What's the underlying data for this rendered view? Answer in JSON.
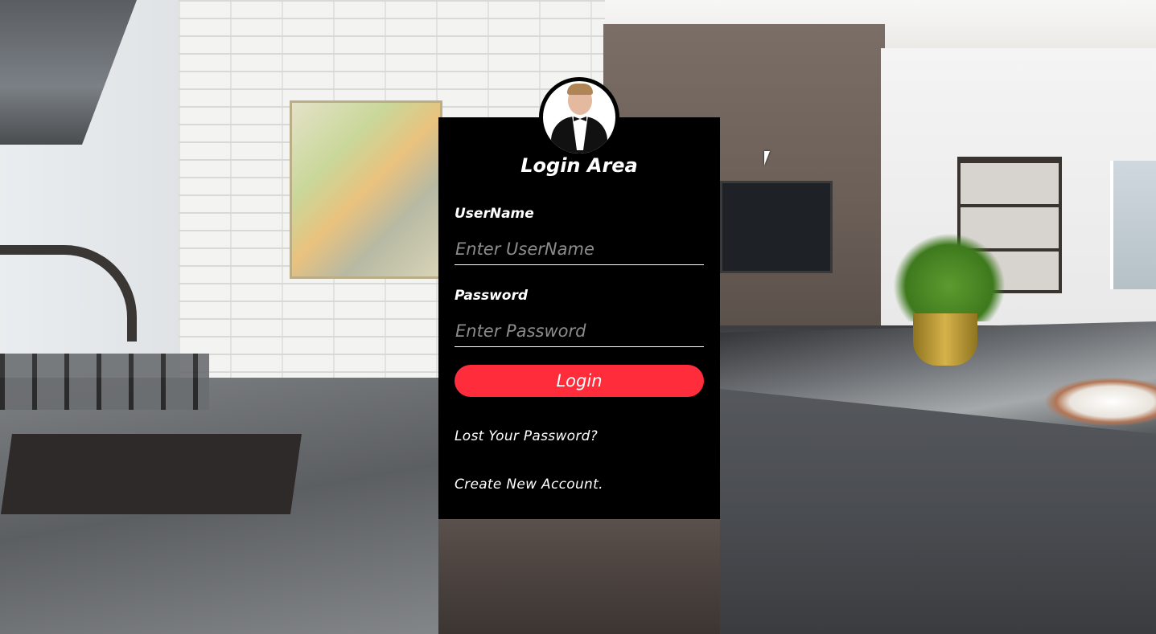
{
  "login": {
    "title": "Login Area",
    "username_label": "UserName",
    "username_placeholder": "Enter UserName",
    "password_label": "Password",
    "password_placeholder": "Enter Password",
    "login_button": "Login",
    "lost_password_link": "Lost Your Password?",
    "create_account_link": "Create New Account."
  },
  "colors": {
    "card_background": "#000000",
    "button": "#ff2d3b",
    "text": "#ffffff",
    "placeholder": "#8c8c8c"
  },
  "icons": {
    "avatar": "user-avatar-icon",
    "cursor": "mouse-pointer-icon"
  }
}
